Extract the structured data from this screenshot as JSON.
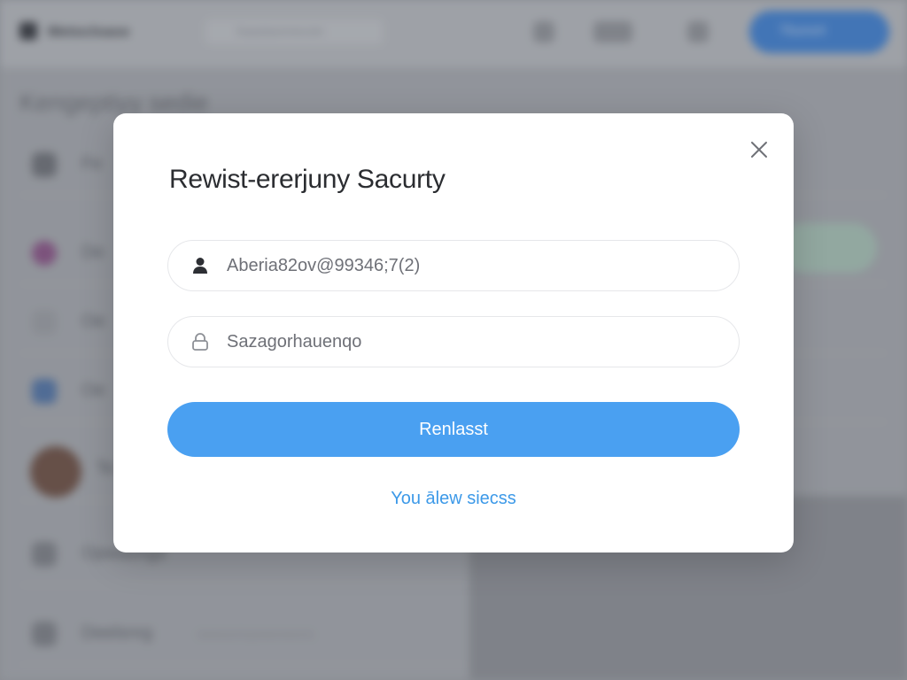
{
  "background": {
    "brand": "Metocloase",
    "search_placeholder": "Saastaonnecsin",
    "heading": "Kengeptiyy sedie",
    "rows": [
      {
        "label": "Fe",
        "sub": ""
      },
      {
        "label": "De",
        "sub": ""
      },
      {
        "label": "Oe",
        "sub": ""
      },
      {
        "label": "Oe",
        "sub": ""
      },
      {
        "label": "Te",
        "sub": ""
      },
      {
        "label": "Opwaongs",
        "sub": ""
      },
      {
        "label": "Deelsnrg",
        "sub": "swesonnyeanneons"
      }
    ],
    "cta_label": "Tbunort",
    "accent_color": "#3a7fd6"
  },
  "modal": {
    "title": "Rewist-ererjuny Sacurty",
    "close_icon": "close-icon",
    "username": {
      "icon": "user-icon",
      "value": "Aberia82ov@99346;7(2)",
      "placeholder": ""
    },
    "password": {
      "icon": "lock-icon",
      "value": "",
      "placeholder": "Sazagorhauenqo"
    },
    "submit_label": "Renlasst",
    "helper_link": "You ālew siecss",
    "accent_color": "#4aa0f1"
  }
}
